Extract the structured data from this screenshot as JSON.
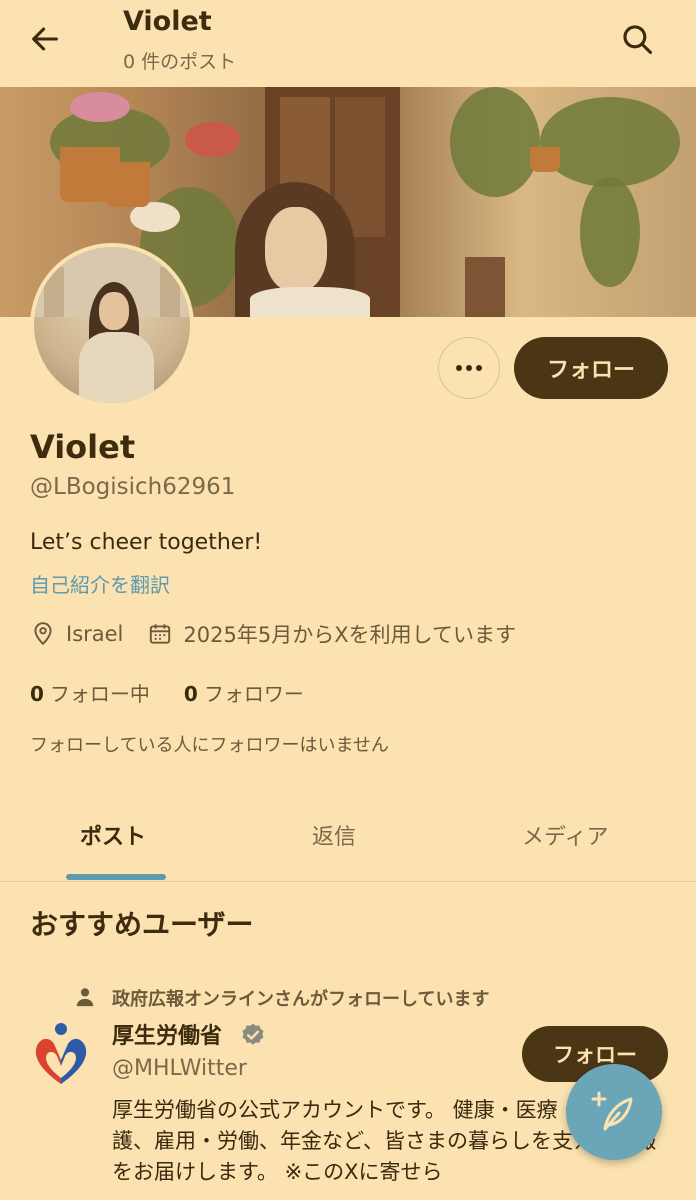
{
  "header": {
    "name": "Violet",
    "post_count": "0 件のポスト"
  },
  "profile": {
    "follow_label": "フォロー",
    "name": "Violet",
    "handle": "@LBogisich62961",
    "bio": "Let’s cheer together!",
    "translate_label": "自己紹介を翻訳",
    "location": "Israel",
    "joined": "2025年5月からXを利用しています",
    "following_count": "0",
    "following_label": "フォロー中",
    "followers_count": "0",
    "followers_label": "フォロワー",
    "no_mutual_followers": "フォローしている人にフォロワーはいません"
  },
  "tabs": [
    {
      "label": "ポスト",
      "active": true
    },
    {
      "label": "返信",
      "active": false
    },
    {
      "label": "メディア",
      "active": false
    }
  ],
  "recommendations": {
    "title": "おすすめユーザー",
    "items": [
      {
        "context": "政府広報オンラインさんがフォローしています",
        "name": "厚生労働省",
        "handle": "@MHLWitter",
        "follow_label": "フォロー",
        "bio": "厚生労働省の公式アカウントです。 健康・医療・福祉・介護、雇用・労働、年金など、皆さまの暮らしを支える情報をお届けします。 ※このXに寄せら"
      }
    ]
  },
  "icons": {
    "back": "arrow-left-icon",
    "search": "search-icon",
    "more": "more-dots-icon",
    "location": "location-pin-icon",
    "calendar": "calendar-icon",
    "person": "person-icon",
    "verified": "verified-badge-icon",
    "compose": "compose-feather-icon"
  },
  "colors": {
    "background": "#fbe2b0",
    "button": "#4a3514",
    "accent": "#5e9ab0"
  }
}
